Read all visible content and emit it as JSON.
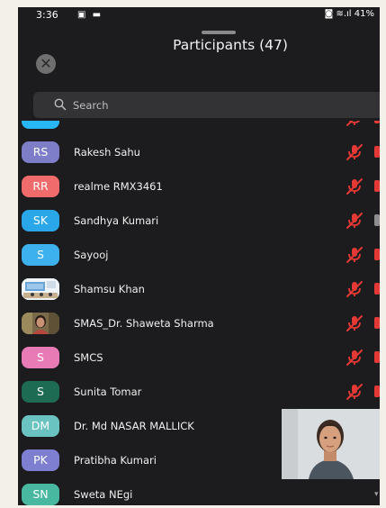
{
  "status_bar": {
    "time": "3:36",
    "notification_icons": "▣ ▬",
    "right_text": "◙ ≋.ıl 41%"
  },
  "header": {
    "title": "Participants (47)"
  },
  "search": {
    "placeholder": "Search"
  },
  "participants": [
    {
      "initials": "",
      "name": "",
      "avatar_color": "#29b6f6",
      "mic": "muted",
      "video": "off"
    },
    {
      "initials": "RS",
      "name": "Rakesh Sahu",
      "avatar_color": "#7e7ec8",
      "mic": "muted",
      "video": "off"
    },
    {
      "initials": "RR",
      "name": "realme RMX3461",
      "avatar_color": "#f06b6b",
      "mic": "muted",
      "video": "off"
    },
    {
      "initials": "SK",
      "name": "Sandhya Kumari",
      "avatar_color": "#2aa7e8",
      "mic": "muted",
      "video": "gray"
    },
    {
      "initials": "S",
      "name": "Sayooj",
      "avatar_color": "#3db0ee",
      "mic": "muted",
      "video": "off"
    },
    {
      "initials": "",
      "name": "Shamsu Khan",
      "avatar_color": "#eaf2f8",
      "avatar_type": "photo-classroom",
      "mic": "muted",
      "video": "off"
    },
    {
      "initials": "",
      "name": "SMAS_Dr. Shaweta Sharma",
      "avatar_color": "#6d5a3a",
      "avatar_type": "photo-person",
      "mic": "muted",
      "video": "off"
    },
    {
      "initials": "S",
      "name": "SMCS",
      "avatar_color": "#e87bb6",
      "mic": "muted",
      "video": "off"
    },
    {
      "initials": "S",
      "name": "Sunita Tomar",
      "avatar_color": "#1e6b54",
      "mic": "muted",
      "video": "off"
    },
    {
      "initials": "DM",
      "name": "Dr. Md NASAR MALLICK",
      "avatar_color": "#6ac3c0",
      "mic": "none",
      "video": "none"
    },
    {
      "initials": "PK",
      "name": "Pratibha Kumari",
      "avatar_color": "#7f7fd1",
      "mic": "none",
      "video": "none"
    },
    {
      "initials": "SN",
      "name": "Sweta NEgi",
      "avatar_color": "#48b8a0",
      "mic": "none",
      "video": "none"
    }
  ],
  "icons": {
    "close": "close-icon",
    "search": "search-icon",
    "mic_muted": "mic-muted-icon",
    "video": "video-icon"
  },
  "colors": {
    "muted_red": "#e53935",
    "background": "#1c1c1e",
    "search_bg": "#333335"
  }
}
